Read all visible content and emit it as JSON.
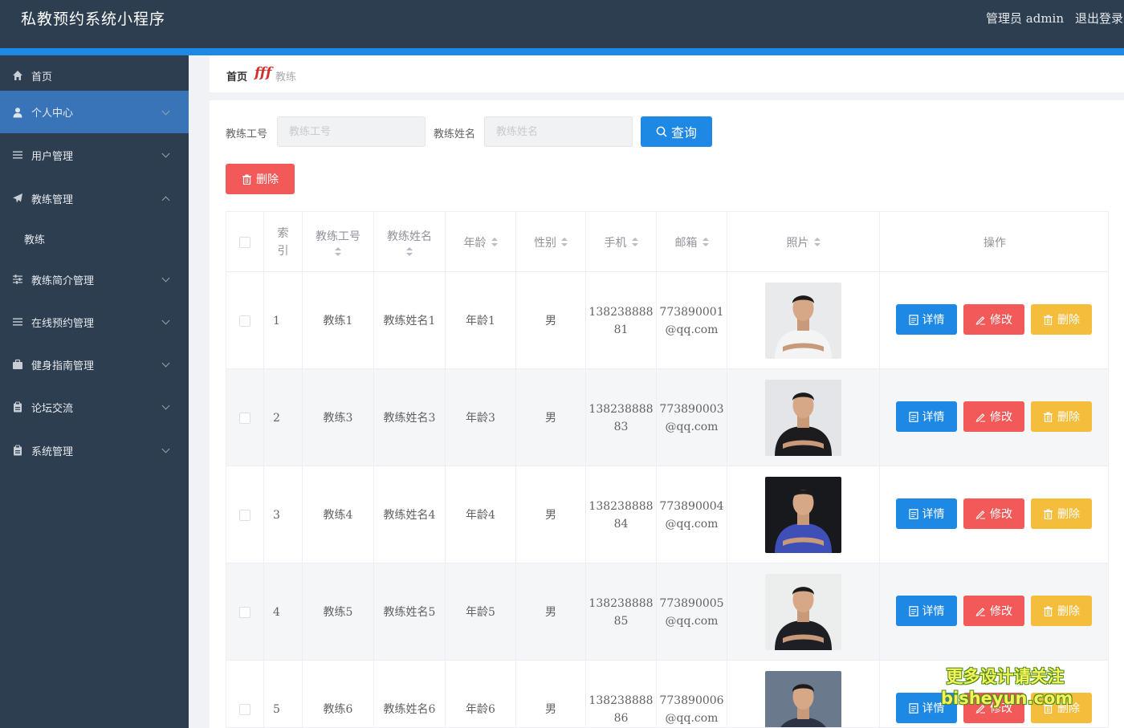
{
  "header": {
    "app_title": "私教预约系统小程序",
    "admin_label": "管理员 admin",
    "logout_label": "退出登录"
  },
  "sidebar": {
    "items": [
      {
        "label": "首页",
        "icon": "home-icon"
      },
      {
        "label": "个人中心",
        "icon": "user-icon"
      },
      {
        "label": "用户管理",
        "icon": "list-icon"
      },
      {
        "label": "教练管理",
        "icon": "send-icon"
      },
      {
        "label": "教练简介管理",
        "icon": "sliders-icon"
      },
      {
        "label": "在线预约管理",
        "icon": "list-icon"
      },
      {
        "label": "健身指南管理",
        "icon": "briefcase-icon"
      },
      {
        "label": "论坛交流",
        "icon": "clipboard-icon"
      },
      {
        "label": "系统管理",
        "icon": "clipboard-icon"
      }
    ],
    "sub_item": "教练"
  },
  "breadcrumb": {
    "home": "首页",
    "separator": "fff",
    "current": "教练"
  },
  "search": {
    "label_id": "教练工号",
    "placeholder_id": "教练工号",
    "label_name": "教练姓名",
    "placeholder_name": "教练姓名",
    "button": "查询"
  },
  "toolbar": {
    "delete_label": "删除"
  },
  "table": {
    "headers": {
      "index_line1": "索",
      "index_line2": "引",
      "coach_id": "教练工号",
      "coach_name": "教练姓名",
      "age": "年龄",
      "gender": "性别",
      "phone": "手机",
      "email": "邮箱",
      "photo": "照片",
      "actions": "操作"
    },
    "rows": [
      {
        "index": "1",
        "coach_id": "教练1",
        "coach_name": "教练姓名1",
        "age": "年龄1",
        "gender": "男",
        "phone_a": "138238888",
        "phone_b": "81",
        "email_a": "773890001",
        "email_b": "@qq.com",
        "shirt": "#f4f4f4",
        "bg": "#e9eaec"
      },
      {
        "index": "2",
        "coach_id": "教练3",
        "coach_name": "教练姓名3",
        "age": "年龄3",
        "gender": "男",
        "phone_a": "138238888",
        "phone_b": "83",
        "email_a": "773890003",
        "email_b": "@qq.com",
        "shirt": "#1c1c1e",
        "bg": "#e4e5e8"
      },
      {
        "index": "3",
        "coach_id": "教练4",
        "coach_name": "教练姓名4",
        "age": "年龄4",
        "gender": "男",
        "phone_a": "138238888",
        "phone_b": "84",
        "email_a": "773890004",
        "email_b": "@qq.com",
        "shirt": "#3e4fb8",
        "bg": "#17191d"
      },
      {
        "index": "4",
        "coach_id": "教练5",
        "coach_name": "教练姓名5",
        "age": "年龄5",
        "gender": "男",
        "phone_a": "138238888",
        "phone_b": "85",
        "email_a": "773890005",
        "email_b": "@qq.com",
        "shirt": "#1e1f24",
        "bg": "#eceded"
      },
      {
        "index": "5",
        "coach_id": "教练6",
        "coach_name": "教练姓名6",
        "age": "年龄6",
        "gender": "男",
        "phone_a": "138238888",
        "phone_b": "86",
        "email_a": "773890006",
        "email_b": "@qq.com",
        "shirt": "#2d3345",
        "bg": "#6a7a8c"
      }
    ],
    "actions": {
      "detail": "详情",
      "edit": "修改",
      "delete": "删除"
    }
  },
  "watermark": {
    "line1": "更多设计请关注",
    "line2": "bisheyun.com"
  },
  "colors": {
    "header_bg": "#2d3e50",
    "accent": "#1e88e5",
    "danger": "#f25a5a",
    "warning": "#f5bd3c",
    "active_nav": "#3a74b8"
  }
}
